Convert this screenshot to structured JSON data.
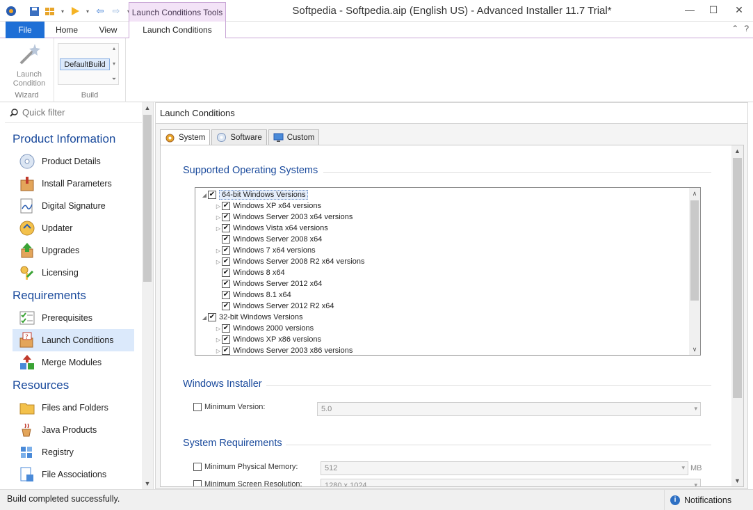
{
  "window": {
    "title": "Softpedia - Softpedia.aip (English US) - Advanced Installer 11.7 Trial*",
    "context_tab_group": "Launch Conditions Tools",
    "controls": {
      "minimize": "—",
      "maximize": "☐",
      "close": "✕"
    }
  },
  "ribbon": {
    "tabs": [
      "File",
      "Home",
      "View",
      "Launch Conditions"
    ],
    "right_buttons": [
      "⌃",
      "?"
    ],
    "wizard_group": {
      "button_label": "Launch Condition",
      "group_label": "Wizard"
    },
    "build_group": {
      "selected": "DefaultBuild",
      "group_label": "Build"
    }
  },
  "sidebar": {
    "filter_placeholder": "Quick filter",
    "sections": [
      {
        "title": "Product Information",
        "items": [
          "Product Details",
          "Install Parameters",
          "Digital Signature",
          "Updater",
          "Upgrades",
          "Licensing"
        ]
      },
      {
        "title": "Requirements",
        "items": [
          "Prerequisites",
          "Launch Conditions",
          "Merge Modules"
        ]
      },
      {
        "title": "Resources",
        "items": [
          "Files and Folders",
          "Java Products",
          "Registry",
          "File Associations"
        ]
      }
    ],
    "selected_item": "Launch Conditions"
  },
  "main": {
    "header": "Launch Conditions",
    "tabs": [
      "System",
      "Software",
      "Custom"
    ],
    "active_tab": "System",
    "sections": {
      "os": "Supported Operating Systems",
      "installer": "Windows Installer",
      "requirements": "System Requirements"
    },
    "os_tree": [
      {
        "label": "64-bit Windows Versions",
        "level": 0,
        "expander": "◢",
        "checked": true,
        "highlight": true
      },
      {
        "label": "Windows XP x64 versions",
        "level": 1,
        "expander": "▷",
        "checked": true
      },
      {
        "label": "Windows Server 2003 x64 versions",
        "level": 1,
        "expander": "▷",
        "checked": true
      },
      {
        "label": "Windows Vista x64 versions",
        "level": 1,
        "expander": "▷",
        "checked": true
      },
      {
        "label": "Windows Server 2008 x64",
        "level": 1,
        "expander": "",
        "checked": true
      },
      {
        "label": "Windows 7 x64 versions",
        "level": 1,
        "expander": "▷",
        "checked": true
      },
      {
        "label": "Windows Server 2008 R2 x64 versions",
        "level": 1,
        "expander": "▷",
        "checked": true
      },
      {
        "label": "Windows 8 x64",
        "level": 1,
        "expander": "",
        "checked": true
      },
      {
        "label": "Windows Server 2012 x64",
        "level": 1,
        "expander": "",
        "checked": true
      },
      {
        "label": "Windows 8.1 x64",
        "level": 1,
        "expander": "",
        "checked": true
      },
      {
        "label": "Windows Server 2012 R2 x64",
        "level": 1,
        "expander": "",
        "checked": true
      },
      {
        "label": "32-bit Windows Versions",
        "level": 0,
        "expander": "◢",
        "checked": true
      },
      {
        "label": "Windows 2000 versions",
        "level": 1,
        "expander": "▷",
        "checked": true
      },
      {
        "label": "Windows XP x86 versions",
        "level": 1,
        "expander": "▷",
        "checked": true
      },
      {
        "label": "Windows Server 2003 x86 versions",
        "level": 1,
        "expander": "▷",
        "checked": true
      }
    ],
    "installer": {
      "label": "Minimum Version:",
      "value": "5.0"
    },
    "requirements": {
      "memory_label": "Minimum Physical Memory:",
      "memory_value": "512",
      "memory_unit": "MB",
      "resolution_label": "Minimum Screen Resolution:",
      "resolution_value": "1280 x 1024"
    }
  },
  "statusbar": {
    "message": "Build completed successfully.",
    "notifications": "Notifications"
  }
}
